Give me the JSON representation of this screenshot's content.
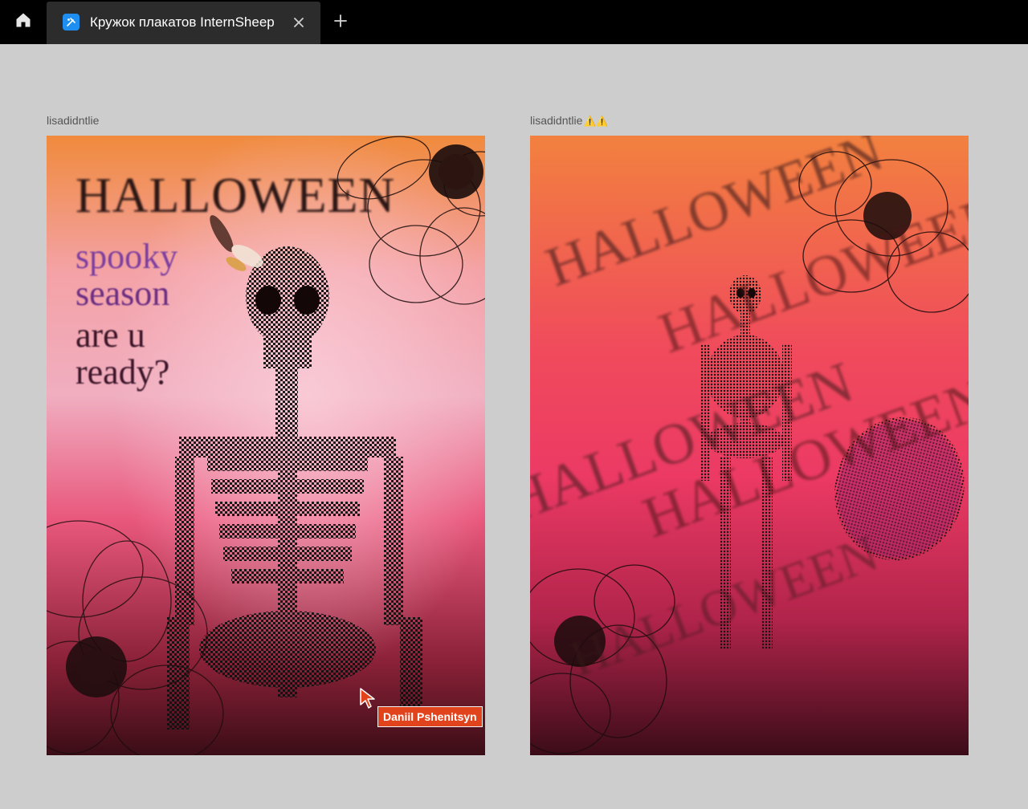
{
  "tabbar": {
    "tab_title": "Кружок плакатов InternSheep",
    "tab_icon": "figma-file-icon",
    "home_icon": "home-icon",
    "close_icon": "close-icon",
    "new_tab_icon": "plus-icon"
  },
  "canvas": {
    "background": "#cdcdcd",
    "frames": [
      {
        "label": "lisadidntlie",
        "badge": "",
        "poster": {
          "title": "HALLOWEEN",
          "lines": [
            "spooky",
            "season",
            "are u",
            "ready?"
          ]
        }
      },
      {
        "label": "lisadidntlie",
        "badge": "⚠️⚠️",
        "poster": {
          "words": [
            "HALLOWEEN"
          ]
        }
      }
    ]
  },
  "collaborator": {
    "name": "Daniil Pshenitsyn",
    "color": "#e1441d"
  }
}
